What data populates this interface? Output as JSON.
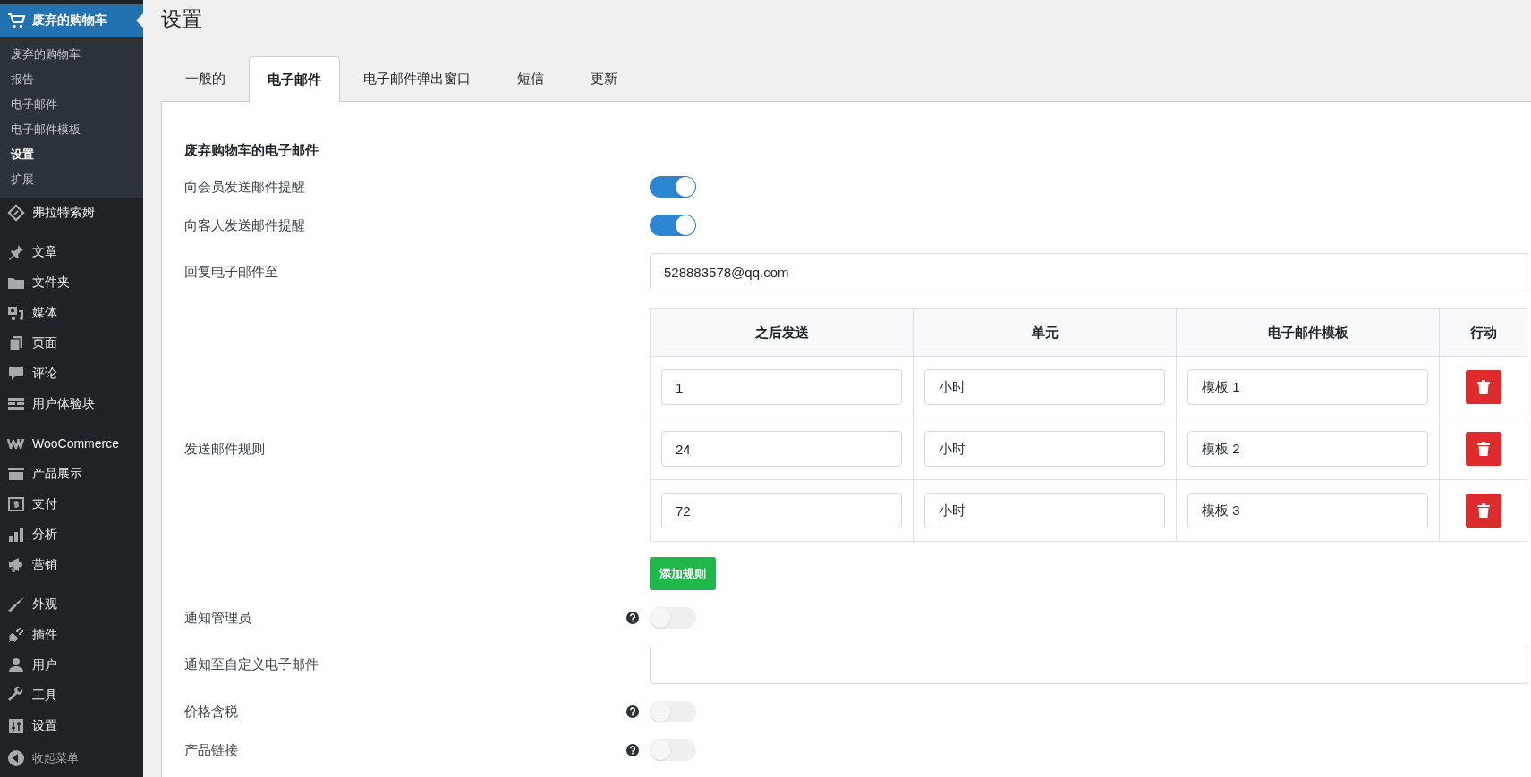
{
  "sidebar": {
    "menu_groups": [
      [
        {
          "label": "废弃的购物车",
          "selected": true,
          "children": [
            {
              "label": "废弃的购物车",
              "selected": false
            },
            {
              "label": "报告",
              "selected": false
            },
            {
              "label": "电子邮件",
              "selected": false
            },
            {
              "label": "电子邮件模板",
              "selected": false
            },
            {
              "label": "设置",
              "selected": true
            },
            {
              "label": "扩展",
              "selected": false
            }
          ]
        },
        {
          "label": "弗拉特索姆",
          "selected": false
        }
      ],
      [
        {
          "label": "文章",
          "selected": false
        },
        {
          "label": "文件夹",
          "selected": false
        },
        {
          "label": "媒体",
          "selected": false
        },
        {
          "label": "页面",
          "selected": false
        },
        {
          "label": "评论",
          "selected": false
        },
        {
          "label": "用户体验块",
          "selected": false
        }
      ],
      [
        {
          "label": "WooCommerce",
          "selected": false
        },
        {
          "label": "产品展示",
          "selected": false
        },
        {
          "label": "支付",
          "selected": false
        },
        {
          "label": "分析",
          "selected": false
        },
        {
          "label": "营销",
          "selected": false
        }
      ],
      [
        {
          "label": "外观",
          "selected": false
        },
        {
          "label": "插件",
          "selected": false
        },
        {
          "label": "用户",
          "selected": false
        },
        {
          "label": "工具",
          "selected": false
        },
        {
          "label": "设置",
          "selected": false
        }
      ]
    ],
    "collapse": "收起菜单"
  },
  "page_title": "设置",
  "tabs": [
    {
      "label": "一般的",
      "selected": false
    },
    {
      "label": "电子邮件",
      "selected": true
    },
    {
      "label": "电子邮件弹出窗口",
      "selected": false
    },
    {
      "label": "短信",
      "selected": false
    },
    {
      "label": "更新",
      "selected": false
    }
  ],
  "form": {
    "heading": "废弃购物车的电子邮件",
    "rows": [
      {
        "kind": "toggle",
        "label": "向会员发送邮件提醒",
        "on": true,
        "help": false
      },
      {
        "kind": "toggle",
        "label": "向客人发送邮件提醒",
        "on": true,
        "help": false
      },
      {
        "kind": "text",
        "label": "回复电子邮件至",
        "value": "528883578@qq.com"
      },
      {
        "kind": "rules",
        "label": "发送邮件规则",
        "columns": [
          "之后发送",
          "单元",
          "电子邮件模板",
          "行动"
        ],
        "rules": [
          {
            "delay": "1",
            "unit": "小时",
            "template": "模板 1"
          },
          {
            "delay": "24",
            "unit": "小时",
            "template": "模板 2"
          },
          {
            "delay": "72",
            "unit": "小时",
            "template": "模板 3"
          }
        ],
        "add_button": "添加规则"
      },
      {
        "kind": "toggle",
        "label": "通知管理员",
        "on": false,
        "help": true
      },
      {
        "kind": "text",
        "label": "通知至自定义电子邮件"
      },
      {
        "kind": "toggle",
        "label": "价格含税",
        "on": false,
        "help": true
      },
      {
        "kind": "toggle",
        "label": "产品链接",
        "on": false,
        "help": true
      }
    ]
  }
}
